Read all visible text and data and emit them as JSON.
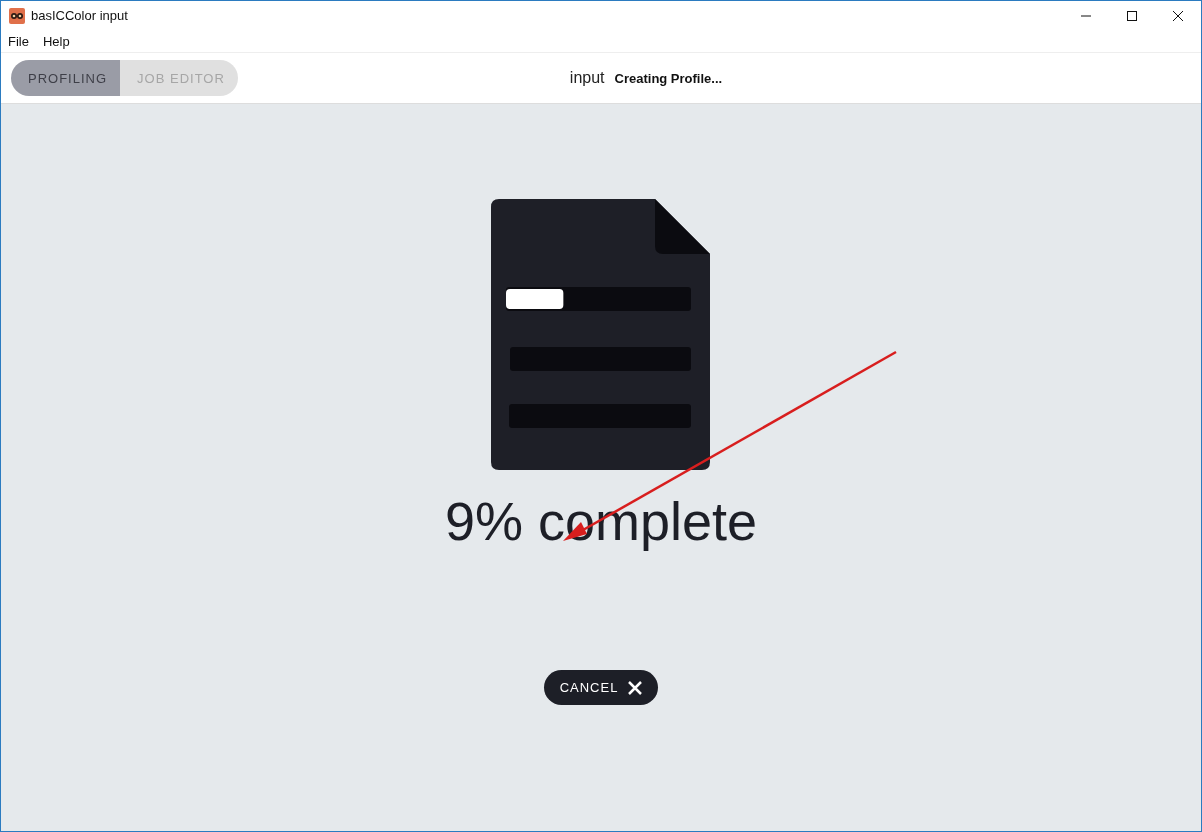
{
  "window": {
    "title": "basICColor input"
  },
  "menu": [
    "File",
    "Help"
  ],
  "mode_tabs": [
    {
      "label": "PROFILING",
      "selected": true
    },
    {
      "label": "JOB EDITOR",
      "selected": false
    }
  ],
  "header": {
    "app_name": "input",
    "status": "Creating Profile..."
  },
  "progress": {
    "level": 0.31,
    "text": "9% complete"
  },
  "cancel_button": {
    "label": "CANCEL"
  }
}
